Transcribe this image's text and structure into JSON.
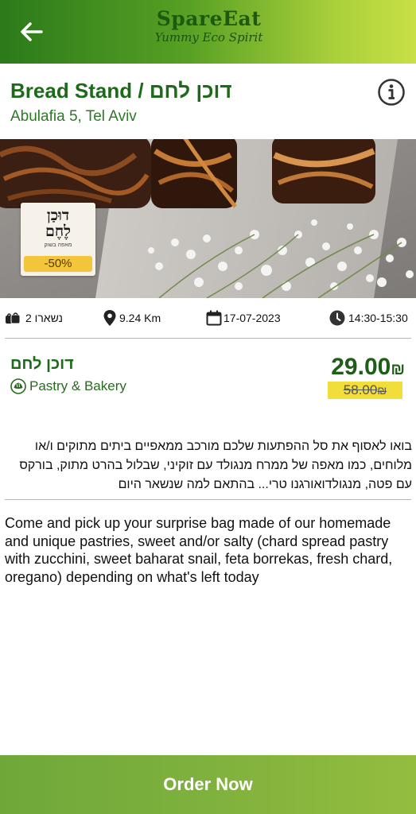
{
  "header": {
    "brand_name": "SpareEat",
    "brand_tagline": "Yummy Eco Spirit",
    "back_icon": "arrow-left-icon",
    "info_icon": "info-circle-icon"
  },
  "store": {
    "title": "Bread Stand / דוכן לחם",
    "address": "Abulafia 5, Tel Aviv",
    "name_he": "דוכן לחם",
    "category": "Pastry & Bakery",
    "category_icon": "bakery-icon"
  },
  "photo": {
    "badge_logo_line1": "דוּכַן",
    "badge_logo_line2": "לֶחֶם",
    "badge_sub": "מאפה בשוק",
    "discount": "-50%"
  },
  "info_row": {
    "remaining": "נשארו 2",
    "remaining_icon": "bags-icon",
    "distance": "9.24 Km",
    "distance_icon": "location-pin-icon",
    "date": "17-07-2023",
    "date_icon": "calendar-icon",
    "time": "14:30-15:30",
    "time_icon": "clock-icon"
  },
  "pricing": {
    "price": "29.00",
    "old_price": "58.00",
    "currency": "₪"
  },
  "description": {
    "hebrew": "בואו לאסוף את סל ההפתעות שלכם מורכב ממאפיים ביתים מתוקים ו/או מלוחים, כמו מאפה של ממרח מנגולד עם זוקיני, שבלול בהרט מתוק, בורקס עם פטה, מנגולדואורגנו טרי... בהתאם למה שנשאר היום",
    "english": "Come and pick up your surprise bag made of our homemade and unique pastries, sweet and/or salty (chard spread pastry with zucchini, sweet baharat snail, feta borrekas, fresh chard, oregano) depending on what's left today"
  },
  "footer": {
    "order_label": "Order Now"
  },
  "colors": {
    "brand_green": "#1e6a1b",
    "header_gradient_start": "#2b7a1a",
    "header_gradient_end": "#c9e047",
    "order_button": "#7fb13d",
    "discount_badge": "#f3c53b",
    "old_price_highlight": "#f1de3a"
  }
}
